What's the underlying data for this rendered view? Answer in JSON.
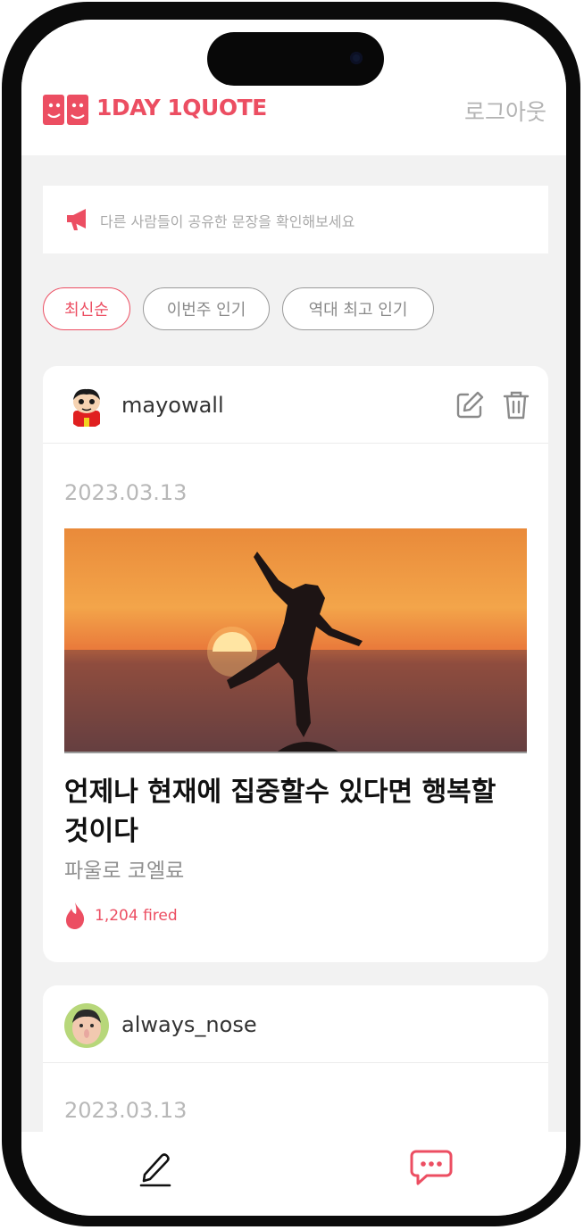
{
  "header": {
    "brand": "1DAY 1QUOTE",
    "logout_label": "로그아웃"
  },
  "notice": {
    "text": "다른 사람들이 공유한 문장을 확인해보세요"
  },
  "filters": {
    "items": [
      {
        "label": "최신순",
        "active": true
      },
      {
        "label": "이번주 인기",
        "active": false
      },
      {
        "label": "역대 최고 인기",
        "active": false
      }
    ]
  },
  "posts": [
    {
      "username": "mayowall",
      "date": "2023.03.13",
      "quote": "언제나 현재에 집중할수 있다면 행복할 것이다",
      "author": "파울로 코엘료",
      "fire_label": "1,204 fired"
    },
    {
      "username": "always_nose",
      "date": "2023.03.13"
    }
  ],
  "icons": {
    "edit": "edit-icon",
    "delete": "trash-icon",
    "notice": "megaphone-icon",
    "fire": "fire-icon",
    "write": "pen-icon",
    "feed": "chat-bubble-icon"
  },
  "colors": {
    "accent": "#ec4e62",
    "background": "#f2f2f2",
    "muted_text": "#b3b3b3"
  }
}
